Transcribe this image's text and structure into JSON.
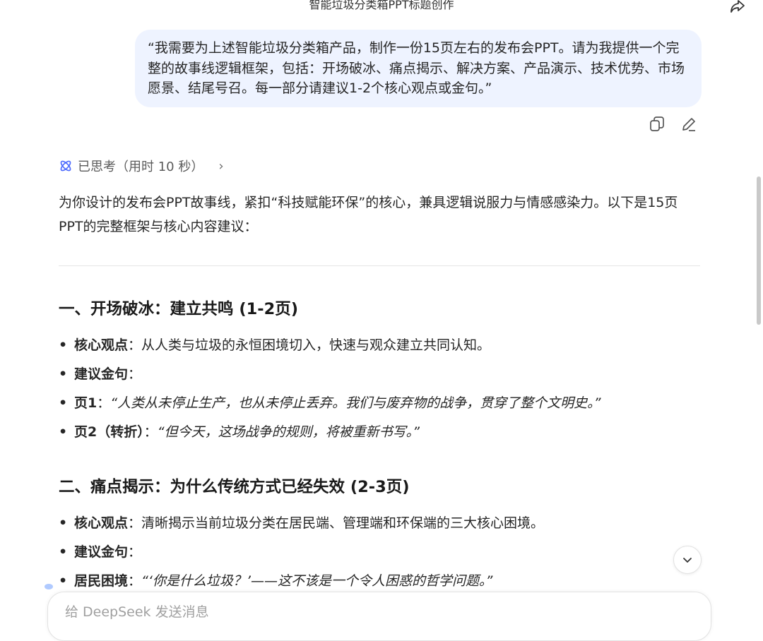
{
  "header": {
    "title": "智能垃圾分类箱PPT标题创作"
  },
  "user_message": {
    "text": "“我需要为上述智能垃圾分类箱产品，制作一份15页左右的发布会PPT。请为我提供一个完整的故事线逻辑框架，包括：开场破冰、痛点揭示、解决方案、产品演示、技术优势、市场愿景、结尾号召。每一部分请建议1-2个核心观点或金句。”"
  },
  "thinking": {
    "label": "已思考（用时 10 秒）"
  },
  "response": {
    "intro": "为你设计的发布会PPT故事线，紧扣“科技赋能环保”的核心，兼具逻辑说服力与情感感染力。以下是15页PPT的完整框架与核心内容建议：",
    "sections": [
      {
        "heading": "一、开场破冰：建立共鸣 (1-2页)",
        "items": [
          {
            "label": "核心观点",
            "sep": "：",
            "text": "从人类与垃圾的永恒困境切入，快速与观众建立共同认知。",
            "quote": ""
          },
          {
            "label": "建议金句",
            "sep": "：",
            "text": "",
            "quote": ""
          },
          {
            "label": "页1",
            "sep": "：",
            "text": "",
            "quote": "“人类从未停止生产，也从未停止丢弃。我们与废弃物的战争，贯穿了整个文明史。”"
          },
          {
            "label": "页2（转折）",
            "sep": "：",
            "text": "",
            "quote": "“但今天，这场战争的规则，将被重新书写。”"
          }
        ]
      },
      {
        "heading": "二、痛点揭示：为什么传统方式已经失效 (2-3页)",
        "items": [
          {
            "label": "核心观点",
            "sep": "：",
            "text": "清晰揭示当前垃圾分类在居民端、管理端和环保端的三大核心困境。",
            "quote": ""
          },
          {
            "label": "建议金句",
            "sep": "：",
            "text": "",
            "quote": ""
          },
          {
            "label": "居民困境",
            "sep": "：",
            "text": "",
            "quote": "“‘你是什么垃圾？’——这不该是一个令人困惑的哲学问题。”"
          }
        ]
      }
    ]
  },
  "composer": {
    "placeholder": "给 DeepSeek 发送消息"
  },
  "icons": {
    "share": "share-icon",
    "copy": "copy-icon",
    "edit": "edit-icon",
    "thinking": "deepthink-icon",
    "chevron": "chevron-right-icon",
    "scroll": "chevron-down-icon"
  },
  "colors": {
    "accent": "#4d6bfe",
    "bubble": "#eef3ff"
  }
}
